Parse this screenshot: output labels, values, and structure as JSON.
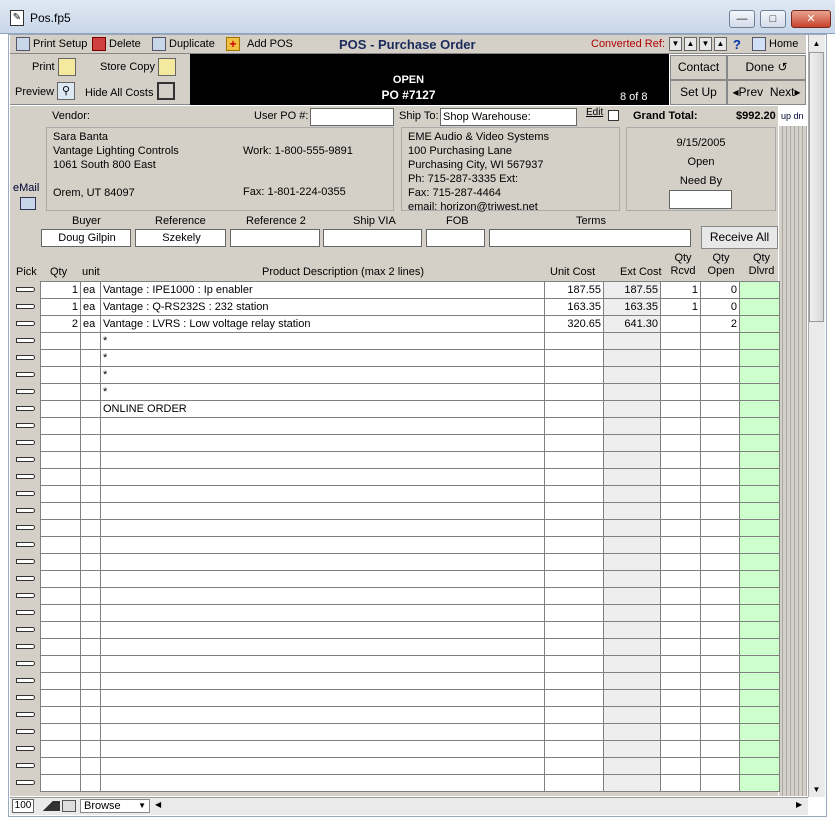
{
  "window": {
    "title": "Pos.fp5",
    "min": "—",
    "max": "□",
    "close": "✕"
  },
  "toolbar": {
    "print_setup": "Print Setup",
    "delete": "Delete",
    "duplicate": "Duplicate",
    "add_pos": "Add POS",
    "title": "POS - Purchase Order",
    "converted_ref": "Converted Ref:",
    "help": "?",
    "home": "Home"
  },
  "header": {
    "print": "Print",
    "store_copy": "Store Copy",
    "preview": "Preview",
    "hide_all_costs": "Hide All Costs",
    "status": "OPEN",
    "po_number": "PO #7127",
    "record_count": "8 of 8",
    "contact": "Contact",
    "done": "Done",
    "setup": "Set Up",
    "prev": "Prev",
    "next": "Next"
  },
  "infobar": {
    "vendor_label": "Vendor:",
    "user_po_label": "User PO #:",
    "user_po_value": "",
    "ship_to_label": "Ship To:",
    "ship_to_value": "Shop Warehouse:",
    "edit": "Edit",
    "grand_total_label": "Grand Total:",
    "grand_total_value": "$992.20",
    "up_dn": "up dn"
  },
  "vendor": {
    "name": "Sara Banta",
    "company": "Vantage Lighting Controls",
    "address1": "1061 South 800 East",
    "city": "Orem, UT 84097",
    "work": "Work: 1-800-555-9891",
    "fax": "Fax: 1-801-224-0355",
    "email_label": "eMail"
  },
  "ship": {
    "company": "EME Audio & Video Systems",
    "address1": "100 Purchasing Lane",
    "city": "Purchasing City, WI 567937",
    "phone": "Ph: 715-287-3335 Ext:",
    "fax": "Fax: 715-287-4464",
    "email": "email: horizon@triwest.net"
  },
  "status_box": {
    "date": "9/15/2005",
    "status": "Open",
    "need_by_label": "Need By",
    "need_by_value": ""
  },
  "meta": {
    "buyer_label": "Buyer",
    "buyer": "Doug Gilpin",
    "reference_label": "Reference",
    "reference": "Szekely",
    "reference2_label": "Reference 2",
    "reference2": "",
    "ship_via_label": "Ship VIA",
    "ship_via": "",
    "fob_label": "FOB",
    "fob": "",
    "terms_label": "Terms",
    "terms": "",
    "receive_all": "Receive All"
  },
  "columns": {
    "pick": "Pick",
    "qty": "Qty",
    "unit": "unit",
    "desc": "Product Description (max 2 lines)",
    "unit_cost": "Unit Cost",
    "ext_cost": "Ext Cost",
    "qty_rcvd": "Qty Rcvd",
    "qty_open": "Qty Open",
    "qty_dlvrd": "Qty Dlvrd"
  },
  "rows": [
    {
      "qty": "1",
      "unit": "ea",
      "desc": "Vantage : IPE1000 : Ip enabler",
      "unit_cost": "187.55",
      "ext_cost": "187.55",
      "rcvd": "1",
      "open": "0",
      "dlvrd": ""
    },
    {
      "qty": "1",
      "unit": "ea",
      "desc": "Vantage : Q-RS232S : 232 station",
      "unit_cost": "163.35",
      "ext_cost": "163.35",
      "rcvd": "1",
      "open": "0",
      "dlvrd": ""
    },
    {
      "qty": "2",
      "unit": "ea",
      "desc": "Vantage : LVRS : Low voltage relay station",
      "unit_cost": "320.65",
      "ext_cost": "641.30",
      "rcvd": "",
      "open": "2",
      "dlvrd": ""
    },
    {
      "qty": "",
      "unit": "",
      "desc": "*",
      "unit_cost": "",
      "ext_cost": "",
      "rcvd": "",
      "open": "",
      "dlvrd": ""
    },
    {
      "qty": "",
      "unit": "",
      "desc": "*",
      "unit_cost": "",
      "ext_cost": "",
      "rcvd": "",
      "open": "",
      "dlvrd": ""
    },
    {
      "qty": "",
      "unit": "",
      "desc": "*",
      "unit_cost": "",
      "ext_cost": "",
      "rcvd": "",
      "open": "",
      "dlvrd": ""
    },
    {
      "qty": "",
      "unit": "",
      "desc": "*",
      "unit_cost": "",
      "ext_cost": "",
      "rcvd": "",
      "open": "",
      "dlvrd": ""
    },
    {
      "qty": "",
      "unit": "",
      "desc": "ONLINE ORDER",
      "unit_cost": "",
      "ext_cost": "",
      "rcvd": "",
      "open": "",
      "dlvrd": ""
    }
  ],
  "empty_rows": 22,
  "statusbar": {
    "zoom": "100",
    "mode": "Browse"
  },
  "colors": {
    "chrome": "#d4d0c8",
    "dlvrd": "#ccffcc",
    "ext": "#eeeeee"
  }
}
